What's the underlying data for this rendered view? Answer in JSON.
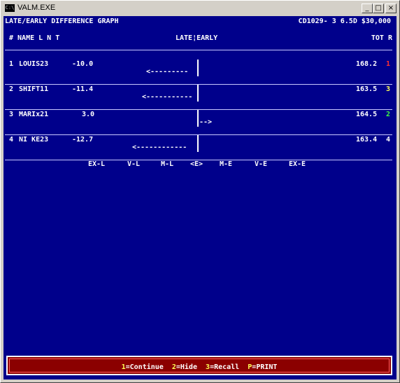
{
  "window": {
    "title": "VALM.EXE",
    "icon_text": "C:\\",
    "minimize": "_",
    "maximize": "□",
    "close": "×"
  },
  "header": {
    "left": "LATE/EARLY DIFFERENCE GRAPH",
    "right": "CD1029- 3 6.5D $30,000"
  },
  "columns": {
    "left": "# NAME L N T",
    "center": "LATE¦EARLY",
    "right": "TOT R"
  },
  "rows": [
    {
      "num": "1",
      "name": "LOUIS23",
      "diff": "-10.0",
      "arrow": "<---------",
      "tot": "168.2",
      "rank": "1"
    },
    {
      "num": "2",
      "name": "SHIFT11",
      "diff": "-11.4",
      "arrow": "<-----------",
      "tot": "163.5",
      "rank": "3"
    },
    {
      "num": "3",
      "name": "MARIx21",
      "diff": "3.0",
      "arrow": "-->",
      "tot": "164.5",
      "rank": "2"
    },
    {
      "num": "4",
      "name": "NI KE23",
      "diff": "-12.7",
      "arrow": "<------------",
      "tot": "163.4",
      "rank": "4"
    }
  ],
  "scale": [
    "EX-L",
    "V-L",
    "M-L",
    "<E>",
    "M-E",
    "V-E",
    "EX-E"
  ],
  "menu": [
    {
      "key": "1",
      "label": "=Continue"
    },
    {
      "key": "2",
      "label": "=Hide"
    },
    {
      "key": "3",
      "label": "=Recall"
    },
    {
      "key": "P",
      "label": "=PRINT"
    }
  ],
  "colors": {
    "screen": "#00008b",
    "bottom_bar": "#8b0000",
    "rank_1": "#ff3030",
    "rank_2": "#40ff40",
    "rank_3": "#ffff55",
    "menu_key": "#ffff55"
  }
}
